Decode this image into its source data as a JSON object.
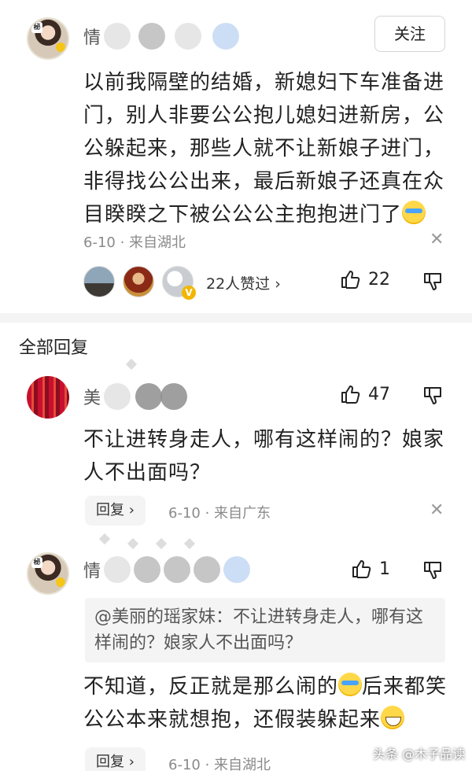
{
  "comment": {
    "author_visible": "情",
    "follow_label": "关注",
    "avatar_seal": "秘",
    "text_parts": [
      "以前我隔壁的结婚，新媳妇下车准备进门，别人非要公公抱儿媳妇进新房，公公躲起来，那些人就不让新娘子进门，非得找公公出来，最后新娘子还真在众目睽睽之下被公公公主抱抱进门了"
    ],
    "meta": "6-10 · 来自湖北",
    "likers_text": "22人赞过 ›",
    "like_count": "22"
  },
  "section_title": "全部回复",
  "replies": [
    {
      "author_visible": "美",
      "text": "不让进转身走人，哪有这样闹的？娘家人不出面吗？",
      "reply_label": "回复 ›",
      "meta": "6-10 · 来自广东",
      "like_count": "47"
    },
    {
      "author_visible": "情",
      "quote": "@美丽的瑶家妹：不让进转身走人，哪有这样闹的？娘家人不出面吗？",
      "text_a": "不知道，反正就是那么闹的",
      "text_b": "后来都笑公公本来就想抱，还假装躲起来",
      "reply_label": "回复 ›",
      "meta": "6-10 · 来自湖北",
      "like_count": "1"
    }
  ],
  "watermark": "头条 @木子品读",
  "icons": {
    "close": "close-icon",
    "thumb_up": "thumb-up-icon",
    "thumb_down": "thumb-down-icon",
    "emoji_cry": "crying-laughing-emoji",
    "emoji_grin": "grinning-emoji"
  }
}
